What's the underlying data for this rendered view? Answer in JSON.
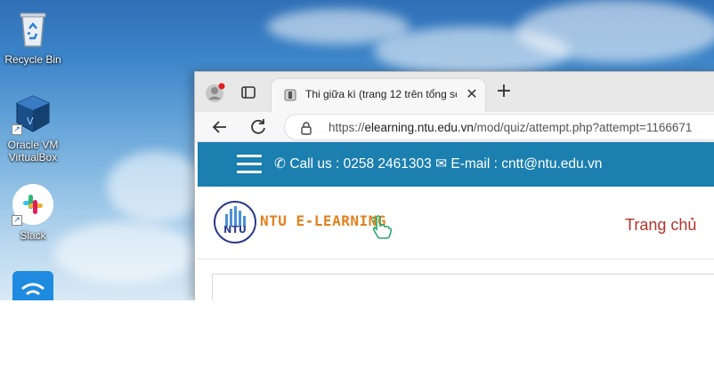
{
  "desktop": {
    "icons": [
      {
        "label": "Recycle Bin",
        "icon": "recycle-bin-icon"
      },
      {
        "label": "Oracle VM VirtualBox",
        "icon": "virtualbox-icon"
      },
      {
        "label": "Slack",
        "icon": "slack-icon"
      },
      {
        "label": "",
        "icon": "wifi-app-icon"
      }
    ]
  },
  "browser": {
    "tab": {
      "title": "Thi giữa kì (trang 12 trên tổng số",
      "close": "✕"
    },
    "new_tab": "+",
    "address": {
      "scheme": "https://",
      "host": "elearning.ntu.edu.vn",
      "path": "/mod/quiz/attempt.php?attempt=1166671"
    }
  },
  "site": {
    "contact": "Call us : 0258 2461303",
    "email": "E-mail : cntt@ntu.edu.vn",
    "logo_text": "NTU E-LEARNING",
    "logo_mark": "NTU",
    "nav_home": "Trang chủ"
  },
  "colors": {
    "topbar": "#1b7fb0",
    "logo_text": "#e4801e",
    "nav_link": "#b5332c"
  }
}
